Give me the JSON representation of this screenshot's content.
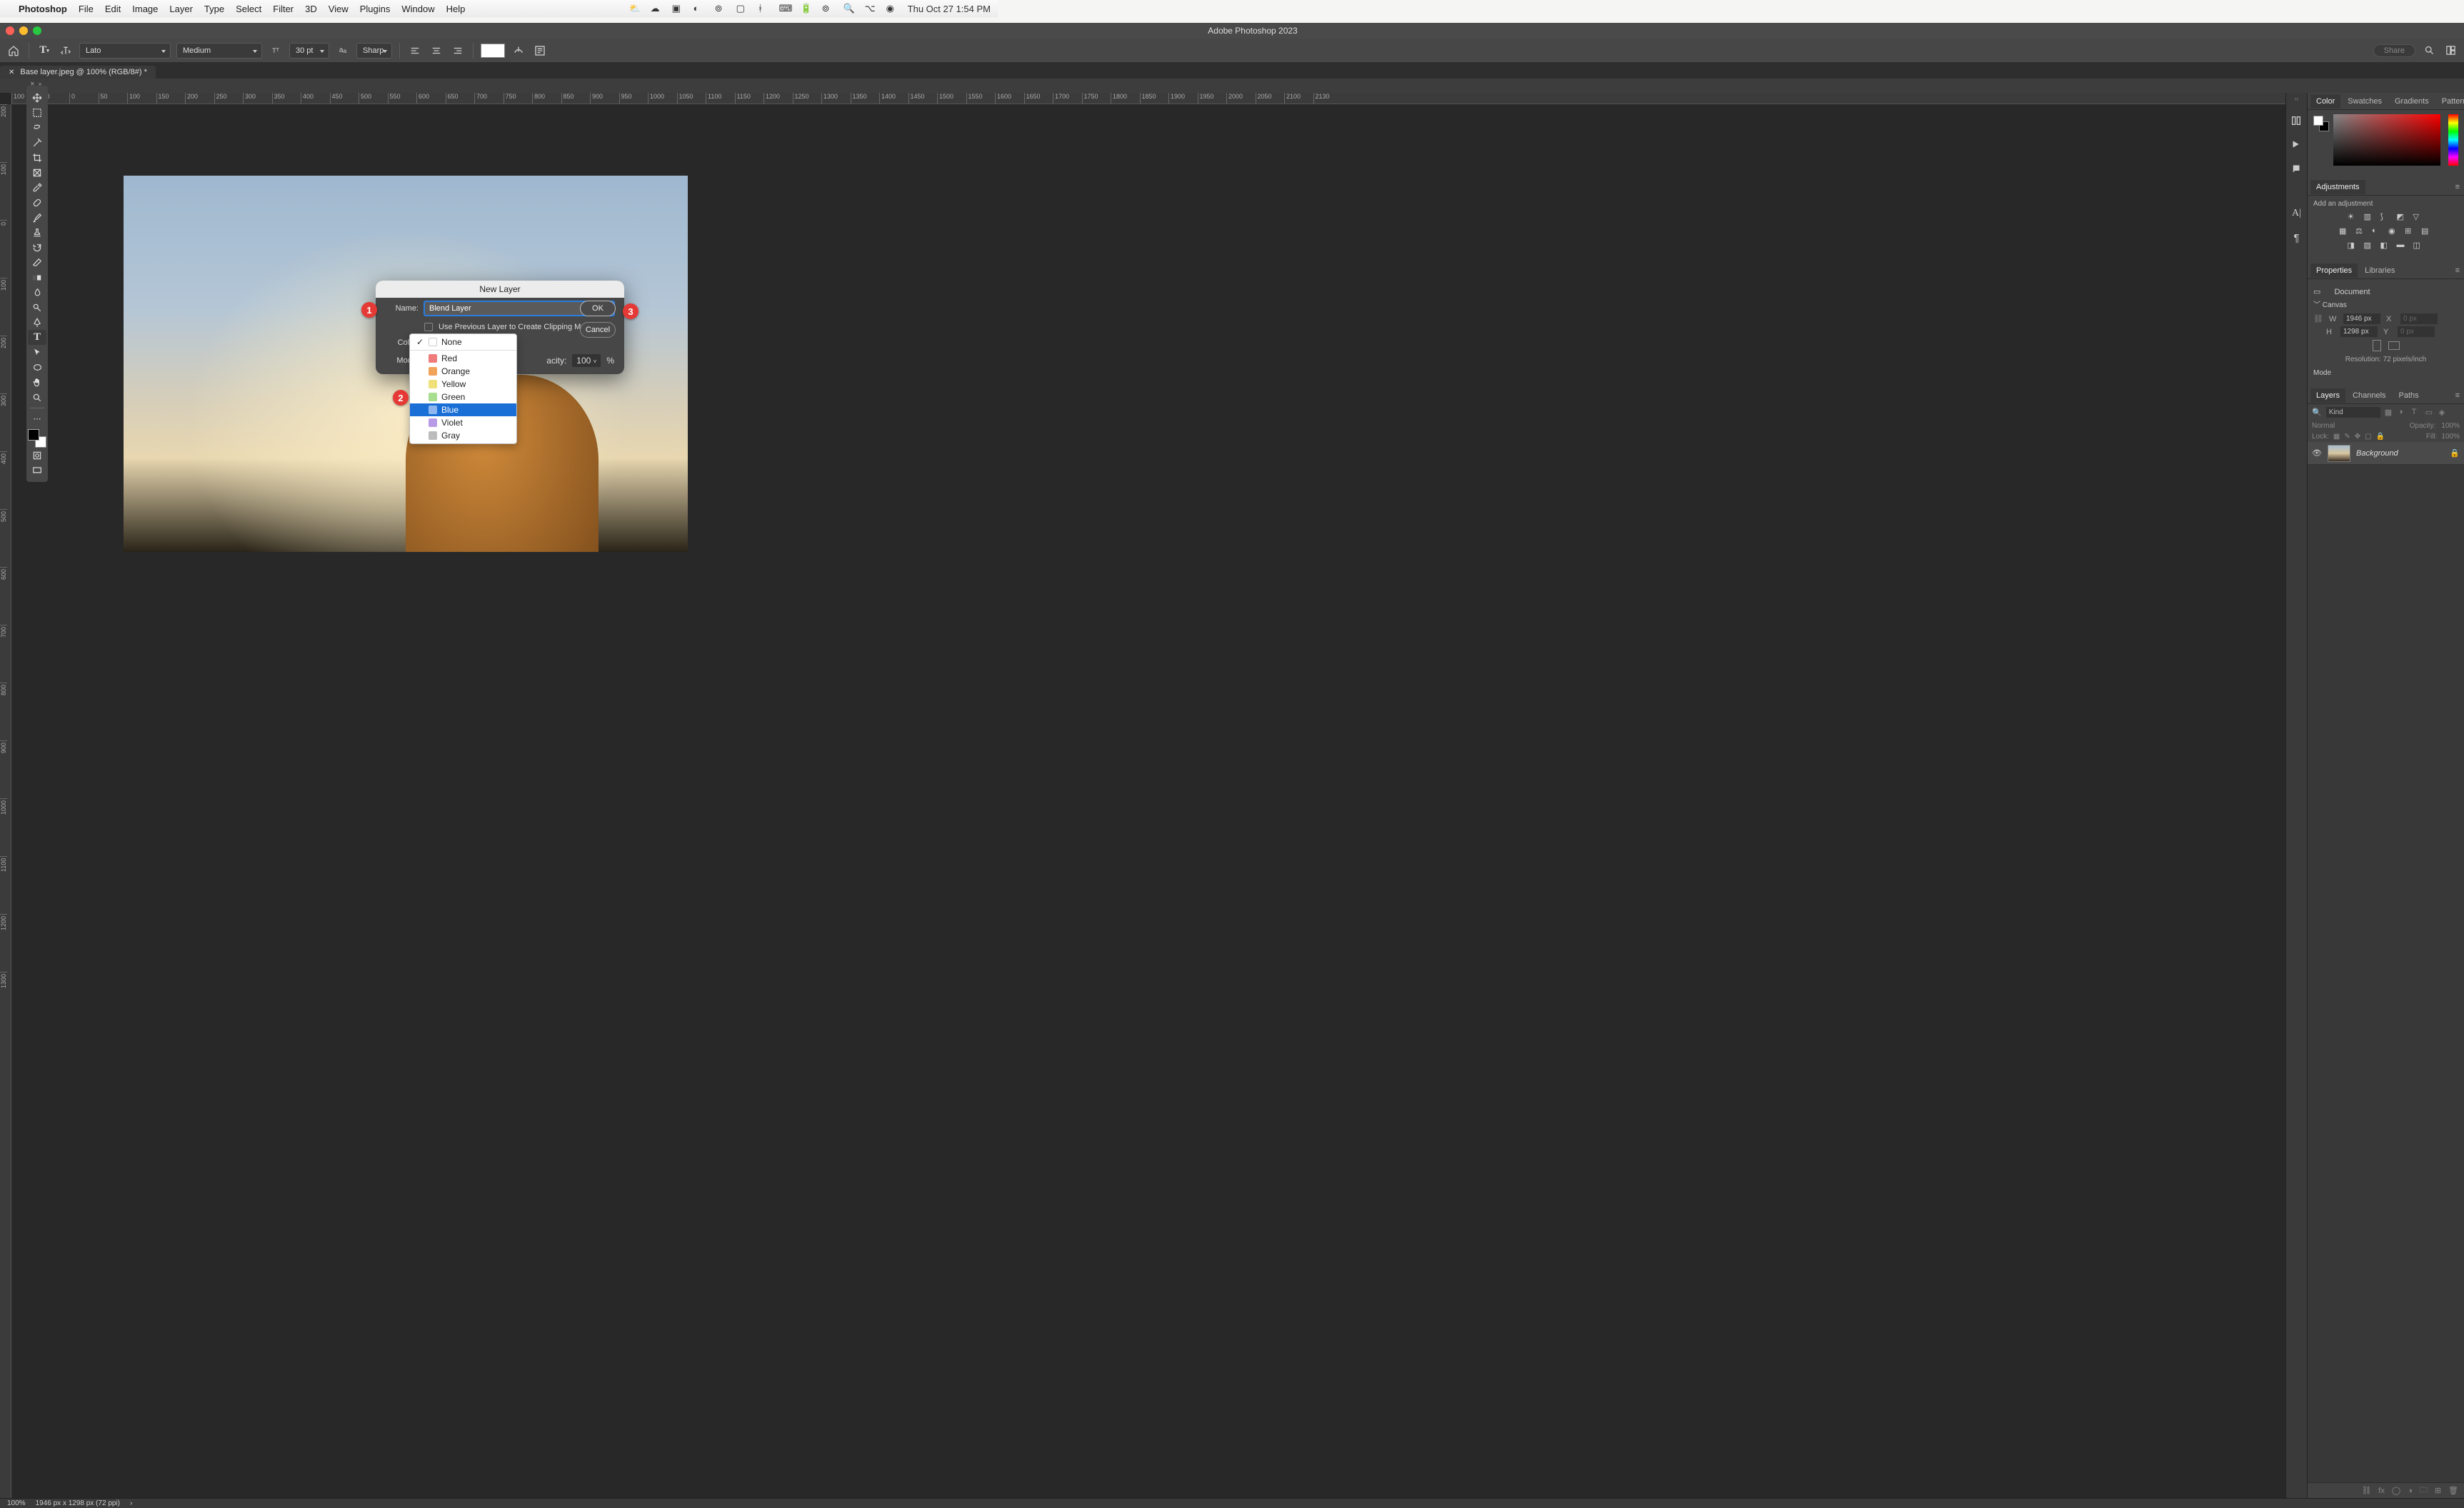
{
  "menubar": {
    "app": "Photoshop",
    "items": [
      "File",
      "Edit",
      "Image",
      "Layer",
      "Type",
      "Select",
      "Filter",
      "3D",
      "View",
      "Plugins",
      "Window",
      "Help"
    ],
    "clock": "Thu Oct 27  1:54 PM"
  },
  "window": {
    "title": "Adobe Photoshop 2023"
  },
  "optionsbar": {
    "font_family": "Lato",
    "font_weight": "Medium",
    "font_size": "30 pt",
    "aa": "Sharp",
    "share": "Share"
  },
  "document": {
    "tab_title": "Base layer.jpeg @ 100% (RGB/8#) *",
    "ruler_h": [
      "100",
      "50",
      "0",
      "50",
      "100",
      "150",
      "200",
      "250",
      "300",
      "350",
      "400",
      "450",
      "500",
      "550",
      "600",
      "650",
      "700",
      "750",
      "800",
      "850",
      "900",
      "950",
      "1000",
      "1050",
      "1100",
      "1150",
      "1200",
      "1250",
      "1300",
      "1350",
      "1400",
      "1450",
      "1500",
      "1550",
      "1600",
      "1650",
      "1700",
      "1750",
      "1800",
      "1850",
      "1900",
      "1950",
      "2000",
      "2050",
      "2100",
      "2130"
    ],
    "ruler_v": [
      "200",
      "100",
      "0",
      "100",
      "200",
      "300",
      "400",
      "500",
      "600",
      "700",
      "800",
      "900",
      "1000",
      "1100",
      "1200",
      "1300"
    ]
  },
  "status": {
    "zoom": "100%",
    "dims": "1946 px x 1298 px (72 ppi)"
  },
  "panels": {
    "color_tabs": [
      "Color",
      "Swatches",
      "Gradients",
      "Patterns"
    ],
    "adjustments": {
      "title": "Adjustments",
      "label": "Add an adjustment"
    },
    "properties": {
      "tabs": [
        "Properties",
        "Libraries"
      ],
      "doc_label": "Document",
      "canvas_label": "Canvas",
      "W": "1946 px",
      "H": "1298 px",
      "X": "0 px",
      "Y": "0 px",
      "resolution": "Resolution: 72 pixels/inch",
      "mode": "Mode"
    },
    "layers": {
      "tabs": [
        "Layers",
        "Channels",
        "Paths"
      ],
      "kind_placeholder": "Kind",
      "blend_mode": "Normal",
      "opacity_label": "Opacity:",
      "opacity_value": "100%",
      "lock_label": "Lock:",
      "fill_label": "Fill:",
      "fill_value": "100%",
      "rows": [
        {
          "name": "Background"
        }
      ]
    }
  },
  "dialog": {
    "title": "New Layer",
    "name_label": "Name:",
    "name_value": "Blend Layer",
    "clip_label": "Use Previous Layer to Create Clipping Mask",
    "color_label": "Color:",
    "mode_label": "Mode:",
    "opacity_partial": "acity:",
    "opacity_value": "100",
    "pct": "%",
    "ok": "OK",
    "cancel": "Cancel"
  },
  "color_dropdown": {
    "none": "None",
    "items": [
      {
        "label": "Red",
        "hex": "#ef7b7b"
      },
      {
        "label": "Orange",
        "hex": "#f2a35a"
      },
      {
        "label": "Yellow",
        "hex": "#efe07a"
      },
      {
        "label": "Green",
        "hex": "#a7df8e"
      },
      {
        "label": "Blue",
        "hex": "#8fb7ef"
      },
      {
        "label": "Violet",
        "hex": "#b79be6"
      },
      {
        "label": "Gray",
        "hex": "#bcbcbc"
      }
    ],
    "selected": "Blue"
  },
  "annotations": {
    "b1": "1",
    "b2": "2",
    "b3": "3"
  }
}
